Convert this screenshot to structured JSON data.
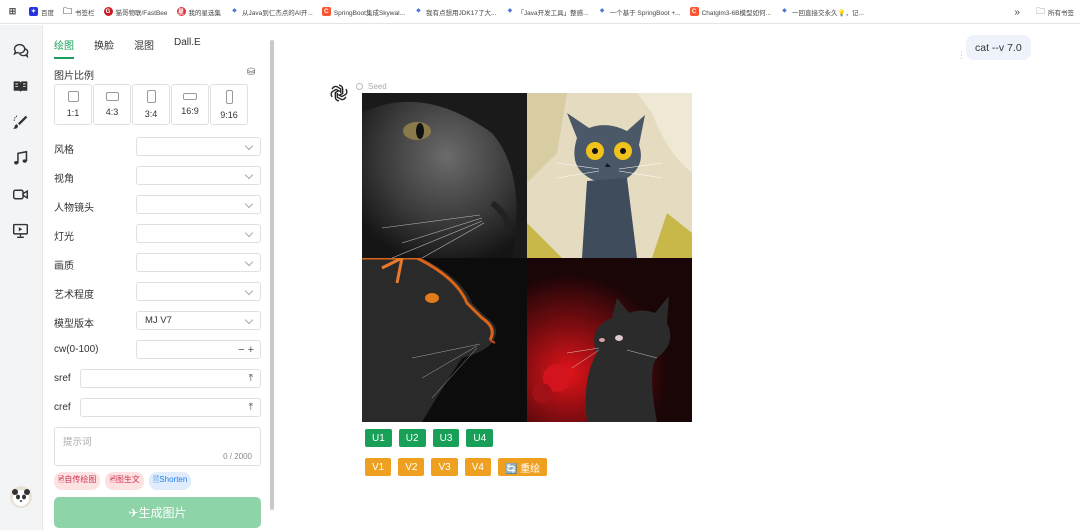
{
  "bookmarks": {
    "items": [
      {
        "label": "",
        "icon": "apps-grid-icon",
        "color": "#666666"
      },
      {
        "label": "百度",
        "icon": "baidu-icon",
        "color": "#2932e1"
      },
      {
        "label": "书签栏",
        "icon": "folder-icon",
        "color": "#666666"
      },
      {
        "label": "猫哥物联/FastBee",
        "icon": "gitee-icon",
        "color": "#c71d23"
      },
      {
        "label": "我的星选集",
        "icon": "xing-icon",
        "color": "#d9363e"
      },
      {
        "label": "从Java到仁杰点的AI开...",
        "icon": "bookmark-icon",
        "color": "#4a76d8"
      },
      {
        "label": "SpringBoot集成Skywal...",
        "icon": "csdn-icon",
        "color": "#fc5531"
      },
      {
        "label": "我有点想用JDK17了大...",
        "icon": "bookmark-icon",
        "color": "#4a76d8"
      },
      {
        "label": "「Java开发工具」整感...",
        "icon": "bookmark-icon",
        "color": "#4a76d8"
      },
      {
        "label": "一个基于 SpringBoot +...",
        "icon": "bookmark-icon",
        "color": "#4a76d8"
      },
      {
        "label": "Chatglm3-6B模型如何...",
        "icon": "csdn-icon",
        "color": "#fc5531"
      },
      {
        "label": "一回直接交永久💡，记...",
        "icon": "bookmark-icon",
        "color": "#4a76d8"
      }
    ],
    "more": "»",
    "all_bookmarks": "所有书签"
  },
  "rail": {
    "items": [
      "chat-icon",
      "book-icon",
      "brush-icon",
      "music-icon",
      "video-icon",
      "presentation-icon"
    ]
  },
  "panel": {
    "tabs": [
      "绘图",
      "换脸",
      "混图",
      "Dall.E"
    ],
    "ratio_label": "图片比例",
    "ratios": [
      "1:1",
      "4:3",
      "3:4",
      "16:9",
      "9:16"
    ],
    "fields": {
      "style": {
        "label": "风格",
        "value": ""
      },
      "view": {
        "label": "视角",
        "value": ""
      },
      "shot": {
        "label": "人物镜头",
        "value": ""
      },
      "light": {
        "label": "灯光",
        "value": ""
      },
      "quality": {
        "label": "画质",
        "value": ""
      },
      "art": {
        "label": "艺术程度",
        "value": ""
      },
      "model": {
        "label": "模型版本",
        "value": "MJ V7"
      }
    },
    "cw_label": "cw(0-100)",
    "cw_controls": "− +",
    "sref_label": "sref",
    "cref_label": "cref",
    "upload_glyph": "⤒",
    "prompt_placeholder": "提示词",
    "prompt_count": "0 / 2000",
    "chips": [
      "🖻自传绘图",
      "🖻图生文",
      "🖹Shorten"
    ],
    "generate_label": "✈生成图片"
  },
  "main": {
    "user_prompt": "cat --v 7.0",
    "seed_label": "Seed",
    "u_buttons": [
      "U1",
      "U2",
      "U3",
      "U4"
    ],
    "v_buttons": [
      "V1",
      "V2",
      "V3",
      "V4"
    ],
    "redo_label": "🔄 重绘"
  },
  "colors": {
    "accent": "#18a058",
    "orange": "#f0a020",
    "generate_disabled": "#8fd3a9"
  }
}
